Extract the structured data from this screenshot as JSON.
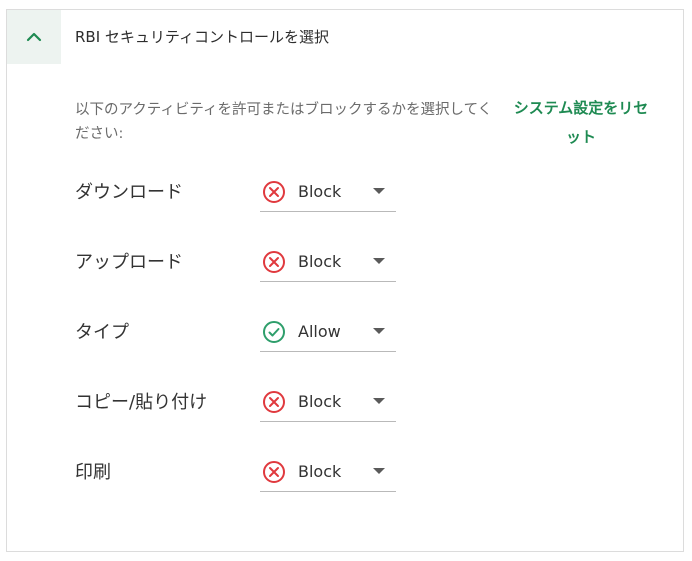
{
  "header": {
    "title": "RBI セキュリティコントロールを選択"
  },
  "description": "以下のアクティビティを許可またはブロックするかを選択してください:",
  "reset_link": "システム設定をリセット",
  "colors": {
    "accent": "#1e8a52",
    "block": "#e0393e",
    "allow": "#2e9e6b"
  },
  "controls": [
    {
      "label": "ダウンロード",
      "value": "Block",
      "icon": "block-icon"
    },
    {
      "label": "アップロード",
      "value": "Block",
      "icon": "block-icon"
    },
    {
      "label": "タイプ",
      "value": "Allow",
      "icon": "allow-icon"
    },
    {
      "label": "コピー/貼り付け",
      "value": "Block",
      "icon": "block-icon"
    },
    {
      "label": "印刷",
      "value": "Block",
      "icon": "block-icon"
    }
  ]
}
